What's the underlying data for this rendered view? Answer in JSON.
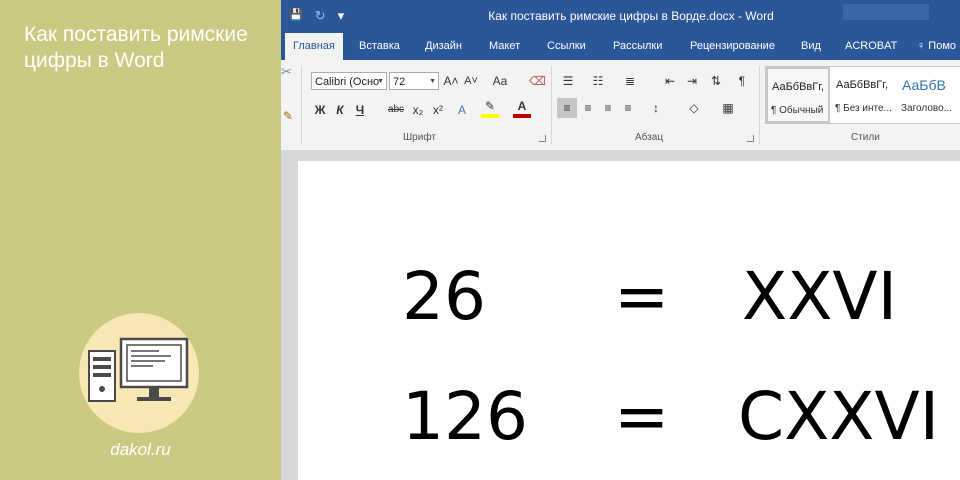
{
  "banner": {
    "title": "Как поставить римские цифры в Word",
    "site": "dakol.ru"
  },
  "window": {
    "doc_title": "Как поставить римские цифры в Ворде.docx - Word",
    "qat": {
      "save": "💾",
      "undo": "↶",
      "redo": "↻",
      "customize": "▾"
    }
  },
  "tabs": [
    "Главная",
    "Вставка",
    "Дизайн",
    "Макет",
    "Ссылки",
    "Рассылки",
    "Рецензирование",
    "Вид",
    "ACROBAT",
    "♀ Помо"
  ],
  "active_tab": "Главная",
  "ribbon": {
    "font_name": "Calibri (Осно",
    "font_size": "72",
    "grow_font": "A˄",
    "shrink_font": "A˅",
    "change_case": "Aa",
    "bold": "Ж",
    "italic": "К",
    "underline": "Ч",
    "strikethrough": "abc",
    "subscript": "x₂",
    "superscript": "x²",
    "font_group_label": "Шрифт",
    "paragraph_group_label": "Абзац",
    "styles_group_label": "Стили",
    "show_marks": "¶",
    "styles": [
      {
        "sample": "АаБбВвГг,",
        "name": "¶ Обычный"
      },
      {
        "sample": "АаБбВвГг,",
        "name": "¶ Без инте..."
      },
      {
        "sample": "АаБбВ",
        "name": "Заголово..."
      }
    ]
  },
  "document": {
    "rows": [
      {
        "arabic": "26",
        "equals": "=",
        "roman": "XXVI"
      },
      {
        "arabic": "126",
        "equals": "=",
        "roman": "CXXVI"
      }
    ]
  },
  "colors": {
    "banner_bg": "#ccc983",
    "word_blue": "#2b579a",
    "ribbon_bg": "#f3f3f3",
    "logo_circle": "#f7e8b6",
    "highlight_yellow": "#ffff00",
    "font_color_red": "#c00000"
  }
}
